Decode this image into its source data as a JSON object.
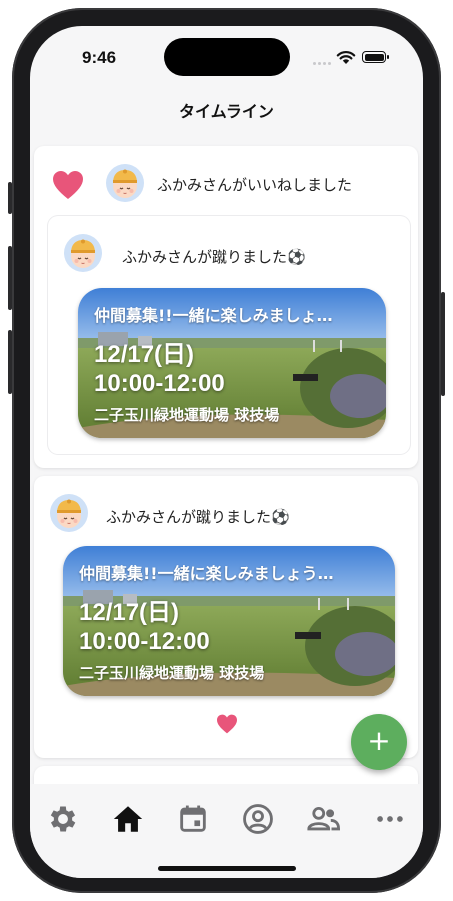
{
  "status_bar": {
    "time": "9:46"
  },
  "header": {
    "title": "タイムライン"
  },
  "timeline": {
    "post1": {
      "like_text": "ふかみさんがいいねしました",
      "inner_text": "ふかみさんが蹴りました⚽",
      "event": {
        "title": "仲間募集!!一緒に楽しみましょ…",
        "date": "12/17(日)",
        "time": "10:00-12:00",
        "venue": "二子玉川緑地運動場 球技場"
      }
    },
    "post2": {
      "text": "ふかみさんが蹴りました⚽",
      "event": {
        "title": "仲間募集!!一緒に楽しみましょう…",
        "date": "12/17(日)",
        "time": "10:00-12:00",
        "venue": "二子玉川緑地運動場 球技場"
      }
    }
  },
  "fab": {
    "label": "+"
  },
  "tab_bar": {
    "items": [
      {
        "icon": "gear-icon",
        "active": false
      },
      {
        "icon": "home-icon",
        "active": true
      },
      {
        "icon": "calendar-icon",
        "active": false
      },
      {
        "icon": "profile-icon",
        "active": false
      },
      {
        "icon": "friends-icon",
        "active": false
      },
      {
        "icon": "more-icon",
        "active": false
      }
    ]
  },
  "colors": {
    "heart": "#e8557a",
    "fab": "#5dae5e",
    "tab_icon": "#6f6f72",
    "tab_active": "#111111"
  }
}
